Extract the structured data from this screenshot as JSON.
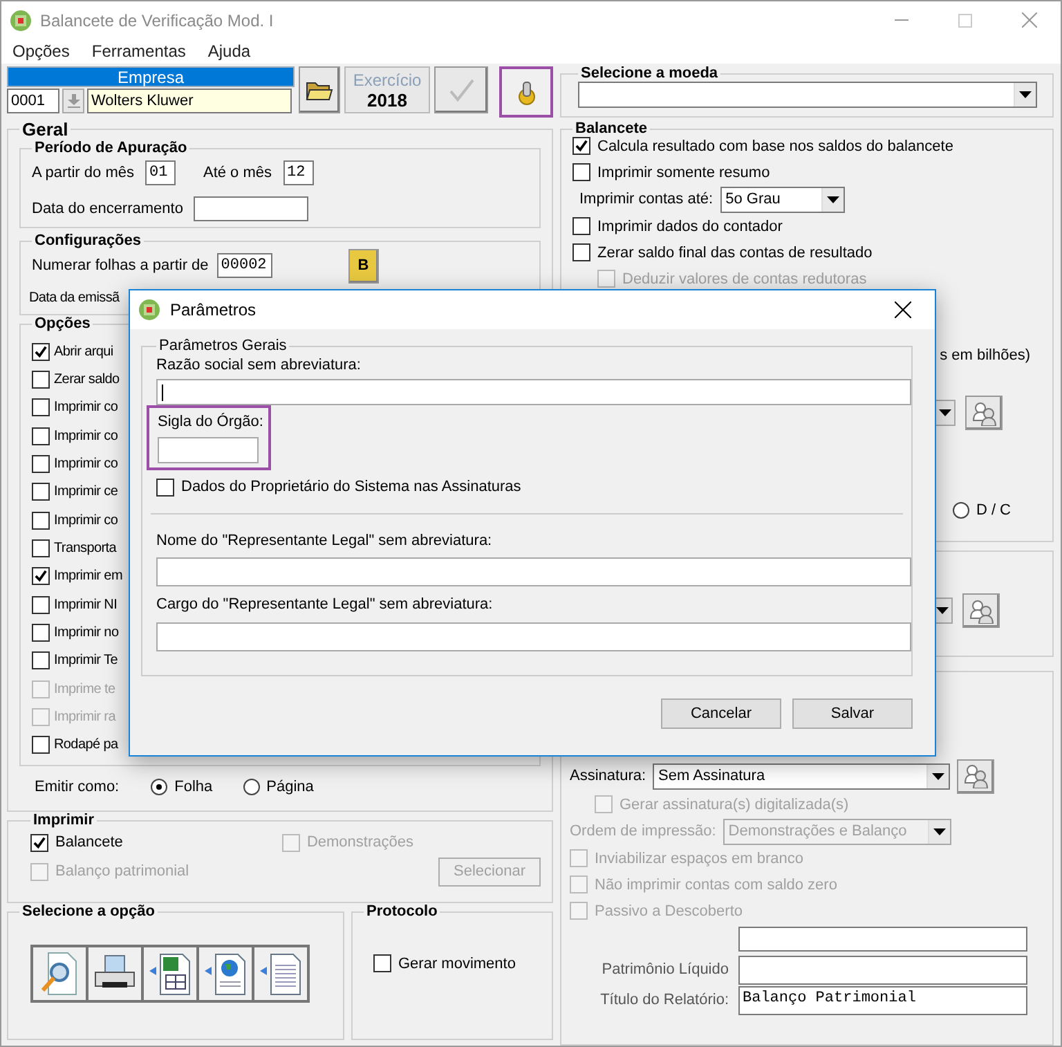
{
  "window": {
    "title": "Balancete de Verificação Mod. I"
  },
  "menu": [
    {
      "label": "Opções"
    },
    {
      "label": "Ferramentas"
    },
    {
      "label": "Ajuda"
    }
  ],
  "empresa": {
    "header": "Empresa",
    "code": "0001",
    "name": "Wolters Kluwer"
  },
  "exercicio": {
    "label": "Exercício",
    "year": "2018"
  },
  "settings_button": {
    "highlighted": true
  },
  "moeda": {
    "title": "Selecione a moeda"
  },
  "geral": {
    "title": "Geral",
    "periodo": {
      "title": "Período de Apuração",
      "from_label": "A partir do mês",
      "from_value": "01",
      "to_label": "Até o mês",
      "to_value": "12",
      "closing_label": "Data do encerramento"
    },
    "configuracoes": {
      "title": "Configurações",
      "numbering_label": "Numerar folhas a partir de",
      "numbering_value": "00002",
      "button": "B",
      "emission_label": "Data da emissã"
    },
    "opcoes": {
      "title": "Opções",
      "items": [
        {
          "label": "Abrir arqui",
          "checked": true,
          "disabled": false
        },
        {
          "label": "Zerar saldo",
          "checked": false,
          "disabled": false
        },
        {
          "label": "Imprimir co",
          "checked": false,
          "disabled": false
        },
        {
          "label": "Imprimir co",
          "checked": false,
          "disabled": false
        },
        {
          "label": "Imprimir co",
          "checked": false,
          "disabled": false
        },
        {
          "label": "Imprimir ce",
          "checked": false,
          "disabled": false
        },
        {
          "label": "Imprimir co",
          "checked": false,
          "disabled": false
        },
        {
          "label": "Transporta",
          "checked": false,
          "disabled": false
        },
        {
          "label": "Imprimir em",
          "checked": true,
          "disabled": false
        },
        {
          "label": "Imprimir NI",
          "checked": false,
          "disabled": false
        },
        {
          "label": "Imprimir no",
          "checked": false,
          "disabled": false
        },
        {
          "label": "Imprimir Te",
          "checked": false,
          "disabled": false
        },
        {
          "label": "Imprime te",
          "checked": false,
          "disabled": true
        },
        {
          "label": "Imprimir ra",
          "checked": false,
          "disabled": true
        },
        {
          "label": "Rodapé pa",
          "checked": false,
          "disabled": false
        }
      ]
    },
    "emitir": {
      "label": "Emitir como:",
      "options": [
        {
          "label": "Folha",
          "selected": true
        },
        {
          "label": "Página",
          "selected": false
        }
      ]
    }
  },
  "imprimir": {
    "title": "Imprimir",
    "items": [
      {
        "label": "Balancete",
        "checked": true,
        "disabled": false
      },
      {
        "label": "Demonstrações",
        "checked": false,
        "disabled": true
      },
      {
        "label": "Balanço patrimonial",
        "checked": false,
        "disabled": true
      }
    ],
    "button": {
      "label": "Selecionar",
      "disabled": true
    }
  },
  "selecione_opcao": {
    "title": "Selecione a opção"
  },
  "protocolo": {
    "title": "Protocolo",
    "item": {
      "label": "Gerar movimento",
      "checked": false,
      "disabled": false
    }
  },
  "balancete": {
    "title": "Balancete",
    "items": [
      {
        "kind": "check",
        "label": "Calcula resultado com base nos saldos do balancete",
        "checked": true,
        "disabled": false
      },
      {
        "kind": "check",
        "label": "Imprimir somente resumo",
        "checked": false,
        "disabled": false
      },
      {
        "kind": "combo",
        "label": "Imprimir contas até:",
        "value": "5o Grau",
        "disabled": false
      },
      {
        "kind": "check",
        "label": "Imprimir dados do contador",
        "checked": false,
        "disabled": false
      },
      {
        "kind": "check",
        "label": "Zerar saldo final das contas de resultado",
        "checked": false,
        "disabled": false
      },
      {
        "kind": "subcheck",
        "label": "Deduzir valores de contas redutoras",
        "checked": false,
        "disabled": true
      }
    ],
    "partial_label": "s em bilhões)",
    "radio": {
      "label": "D / C",
      "selected": false
    }
  },
  "assinaturas": {
    "items": [
      {
        "kind": "combo_button",
        "label": "Assinatura:",
        "value": "Sem Assinatura",
        "disabled": false
      },
      {
        "kind": "subcheck",
        "label": "Gerar assinatura(s) digitalizada(s)",
        "checked": false,
        "disabled": true
      },
      {
        "kind": "combo",
        "label": "Ordem de impressão:",
        "value": "Demonstrações e Balanço",
        "disabled": true
      },
      {
        "kind": "check",
        "label": "Inviabilizar espaços em branco",
        "checked": false,
        "disabled": true
      },
      {
        "kind": "check",
        "label": "Não imprimir contas com saldo zero",
        "checked": false,
        "disabled": true
      },
      {
        "kind": "check",
        "label": "Passivo a Descoberto",
        "checked": false,
        "disabled": true
      },
      {
        "kind": "field"
      },
      {
        "kind": "field",
        "label": "Patrimônio Líquido"
      },
      {
        "kind": "field",
        "label": "Título do Relatório:",
        "value": "Balanço Patrimonial"
      }
    ]
  },
  "dialog": {
    "title": "Parâmetros",
    "group": "Parâmetros Gerais",
    "razao": {
      "label": "Razão social sem abreviatura:",
      "focused": true
    },
    "sigla": {
      "label": "Sigla do Órgão:",
      "highlighted": true
    },
    "owner": {
      "label": "Dados do Proprietário do Sistema nas Assinaturas",
      "checked": false,
      "disabled": false
    },
    "nome": {
      "label": "Nome do \"Representante Legal\" sem abreviatura:"
    },
    "cargo": {
      "label": "Cargo do \"Representante Legal\" sem abreviatura:"
    },
    "buttons": [
      {
        "label": "Cancelar"
      },
      {
        "label": "Salvar"
      }
    ]
  }
}
